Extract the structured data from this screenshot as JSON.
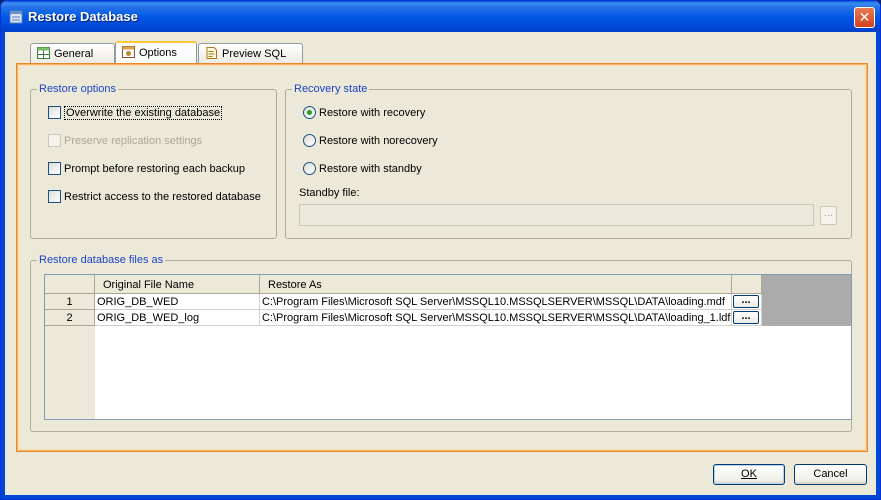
{
  "window": {
    "title": "Restore Database",
    "close_glyph": "✕"
  },
  "tabs": [
    {
      "label": "General",
      "icon": "grid-icon"
    },
    {
      "label": "Options",
      "icon": "gear-grid-icon"
    },
    {
      "label": "Preview SQL",
      "icon": "sql-doc-icon"
    }
  ],
  "restore_options": {
    "title": "Restore options",
    "items": [
      {
        "label": "Overwrite the existing database",
        "checked": false,
        "enabled": true
      },
      {
        "label": "Preserve replication settings",
        "checked": false,
        "enabled": false
      },
      {
        "label": "Prompt before restoring each backup",
        "checked": false,
        "enabled": true
      },
      {
        "label": "Restrict access to the restored database",
        "checked": false,
        "enabled": true
      }
    ]
  },
  "recovery_state": {
    "title": "Recovery state",
    "options": [
      {
        "label": "Restore with recovery",
        "selected": true
      },
      {
        "label": "Restore with norecovery",
        "selected": false
      },
      {
        "label": "Restore with standby",
        "selected": false
      }
    ],
    "standby_label": "Standby file:",
    "standby_value": "",
    "browse_label": "..."
  },
  "files": {
    "title": "Restore database files as",
    "columns": [
      "Original File Name",
      "Restore As"
    ],
    "rows": [
      {
        "num": "1",
        "original": "ORIG_DB_WED",
        "restore_as": "C:\\Program Files\\Microsoft SQL Server\\MSSQL10.MSSQLSERVER\\MSSQL\\DATA\\loading.mdf",
        "browse": "..."
      },
      {
        "num": "2",
        "original": "ORIG_DB_WED_log",
        "restore_as": "C:\\Program Files\\Microsoft SQL Server\\MSSQL10.MSSQLSERVER\\MSSQL\\DATA\\loading_1.ldf",
        "browse": "..."
      }
    ]
  },
  "buttons": {
    "ok": "OK",
    "cancel": "Cancel"
  },
  "colors": {
    "accent_tab": "#ffc83c",
    "group_title": "#1c44c7",
    "panel_border": "#e38a2c",
    "titlebar": "#0055e5"
  }
}
